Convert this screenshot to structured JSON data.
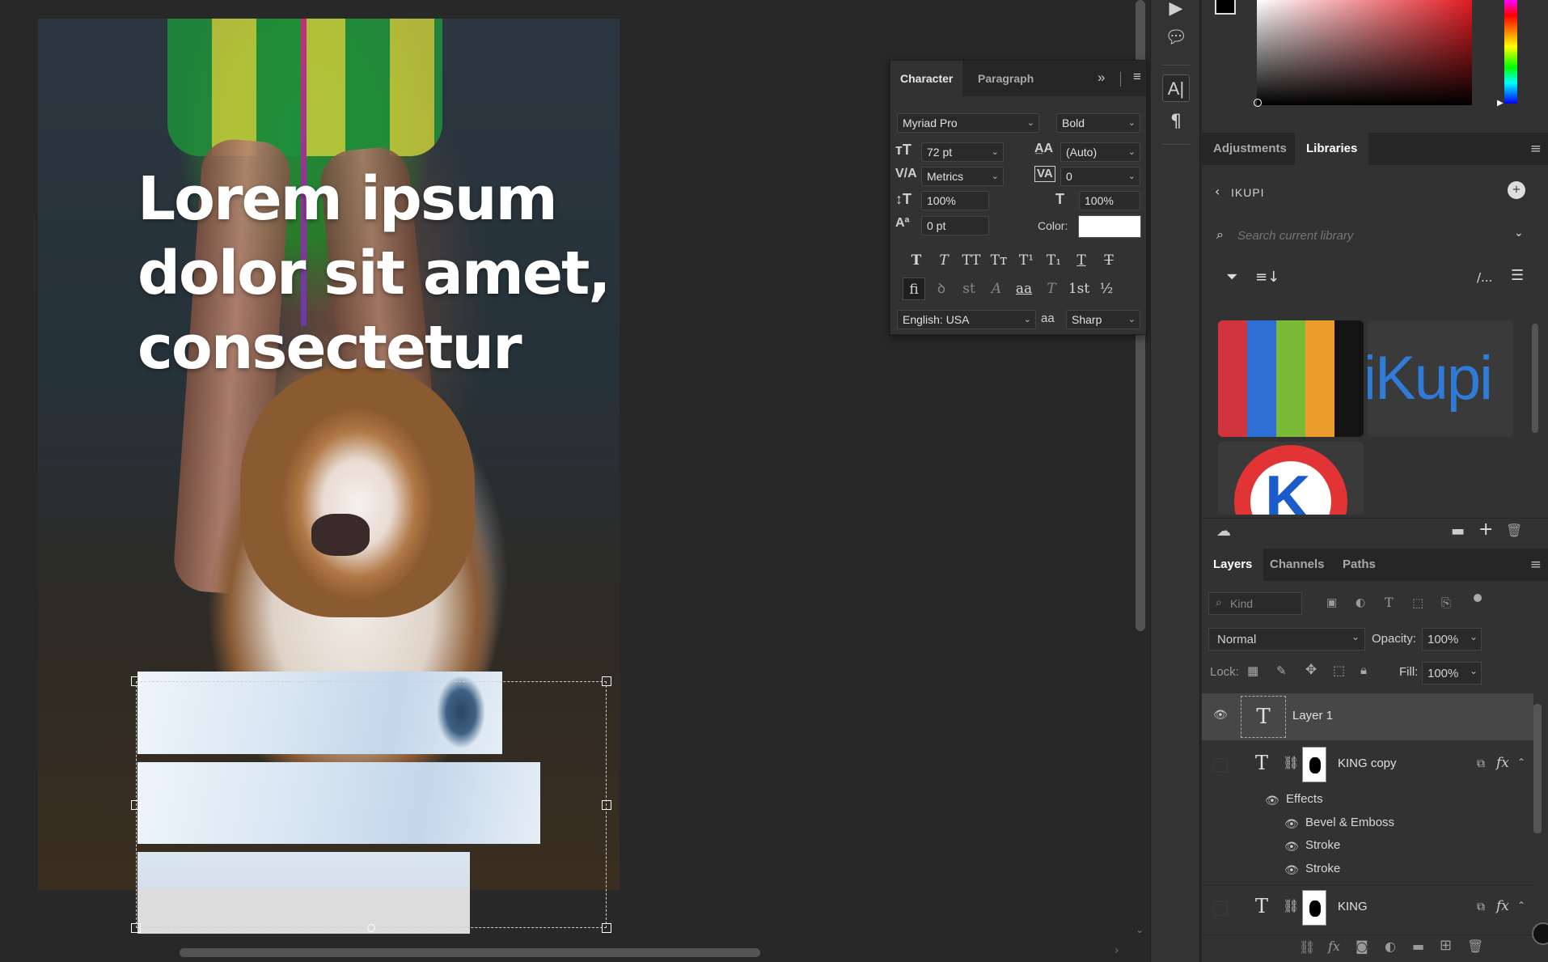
{
  "document": {
    "headline_lines": [
      "Lorem ipsum",
      "dolor sit amet,",
      "consectetur"
    ]
  },
  "character_panel": {
    "tabs": [
      "Character",
      "Paragraph"
    ],
    "font_family": "Myriad Pro",
    "font_style": "Bold",
    "font_size": "72 pt",
    "leading": "(Auto)",
    "kerning": "Metrics",
    "tracking": "0",
    "vertical_scale": "100%",
    "horizontal_scale": "100%",
    "baseline_shift": "0 pt",
    "color_label": "Color:",
    "color_value": "#ffffff",
    "language": "English: USA",
    "antialias_label": "aa",
    "antialias": "Sharp",
    "style_buttons": [
      "T",
      "T",
      "TT",
      "Tт",
      "T¹",
      "T₁",
      "T",
      "T"
    ],
    "opentype_buttons": [
      "fi",
      "ꝺ",
      "st",
      "A",
      "aa",
      "T",
      "1st",
      "½"
    ]
  },
  "libraries_panel": {
    "tabs": [
      "Adjustments",
      "Libraries"
    ],
    "library_name": "IKUPI",
    "search_placeholder": "Search current library",
    "ikupi_logo_text": "iKupi",
    "k_logo_letter": "K"
  },
  "layers_panel": {
    "tabs": [
      "Layers",
      "Channels",
      "Paths"
    ],
    "kind_placeholder": "Kind",
    "blend_mode": "Normal",
    "opacity_label": "Opacity:",
    "opacity": "100%",
    "lock_label": "Lock:",
    "fill_label": "Fill:",
    "fill": "100%",
    "layers": [
      {
        "name": "Layer 1",
        "type_glyph": "T",
        "selected": true
      },
      {
        "name": "KING copy",
        "type_glyph": "T",
        "selected": false
      },
      {
        "name": "KING",
        "type_glyph": "T",
        "selected": false
      }
    ],
    "effects_label": "Effects",
    "effects": [
      "Bevel & Emboss",
      "Stroke",
      "Stroke"
    ],
    "fx_label": "fx"
  },
  "colors": {
    "accent_blue": "#1473e6",
    "selected_row": "#474747"
  }
}
